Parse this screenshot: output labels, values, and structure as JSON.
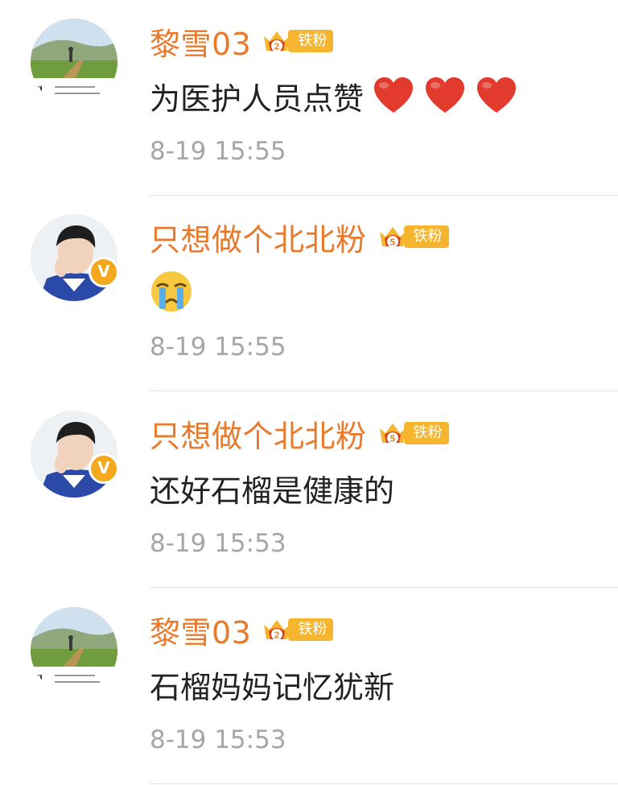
{
  "comments": [
    {
      "username": "黎雪03",
      "fan_level": "2",
      "fan_label": "铁粉",
      "text": "为医护人员点赞",
      "emojis": [
        "red-heart",
        "red-heart",
        "red-heart"
      ],
      "time": "8-19 15:55",
      "avatar": "landscape-photo",
      "verified": false
    },
    {
      "username": "只想做个北北粉",
      "fan_level": "5",
      "fan_label": "铁粉",
      "text": "",
      "emojis": [
        "crying-face"
      ],
      "time": "8-19 15:55",
      "avatar": "person-photo",
      "verified": true,
      "verified_glyph": "V"
    },
    {
      "username": "只想做个北北粉",
      "fan_level": "5",
      "fan_label": "铁粉",
      "text": "还好石榴是健康的",
      "emojis": [],
      "time": "8-19 15:53",
      "avatar": "person-photo",
      "verified": true,
      "verified_glyph": "V"
    },
    {
      "username": "黎雪03",
      "fan_level": "2",
      "fan_label": "铁粉",
      "text": "石榴妈妈记忆犹新",
      "emojis": [],
      "time": "8-19 15:53",
      "avatar": "landscape-photo",
      "verified": false
    }
  ],
  "colors": {
    "username": "#ea7a2b",
    "fan_badge": "#f5b52e",
    "verified_badge": "#f3a81d",
    "text": "#222222",
    "timestamp": "#a6a6a6",
    "divider": "#e4e4e4"
  }
}
